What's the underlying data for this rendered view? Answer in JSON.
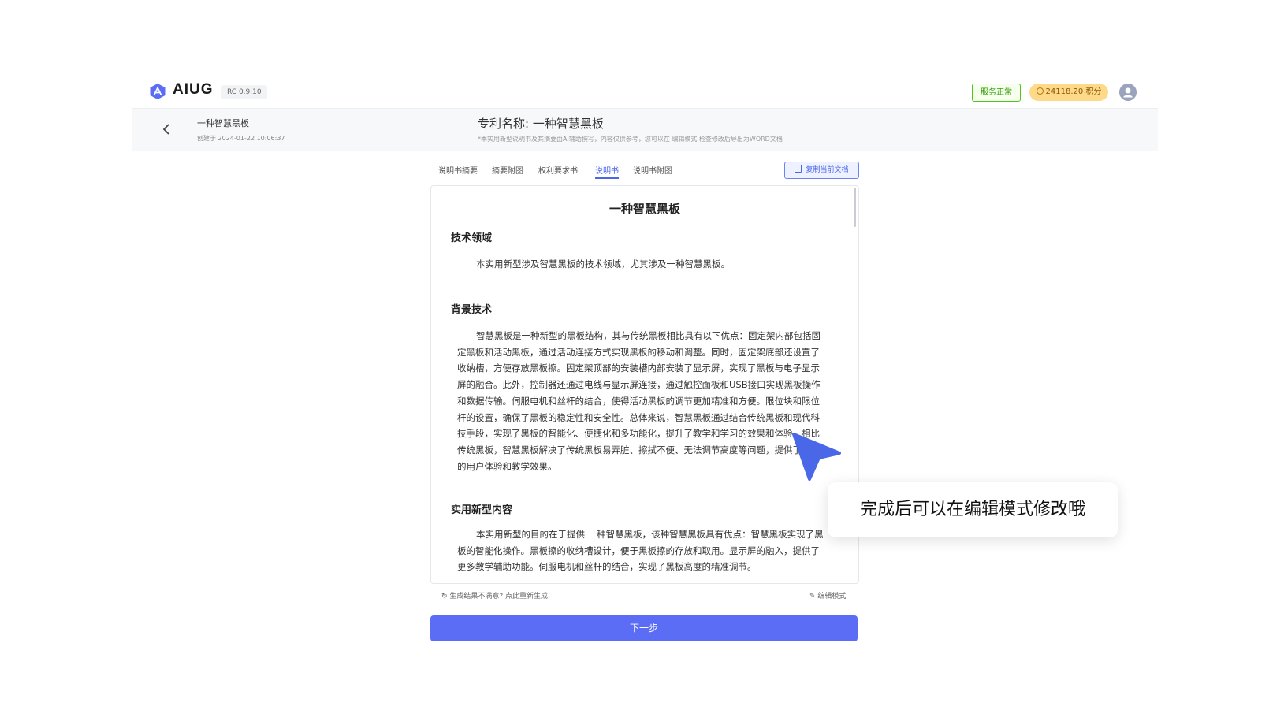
{
  "app": {
    "name": "AIUG",
    "version": "RC 0.9.10"
  },
  "topbar": {
    "status": "服务正常",
    "points": "24118.20 积分"
  },
  "header": {
    "doc_title": "一种智慧黑板",
    "created": "创建于 2024-01-22 10:06:37",
    "patent_name": "专利名称:   一种智慧黑板",
    "note": "*本实用新型说明书及其摘要由AI辅助撰写，内容仅供参考，您可以在 编辑模式 检查修改后导出为WORD文档"
  },
  "tabs": [
    {
      "label": "说明书摘要",
      "active": false
    },
    {
      "label": "摘要附图",
      "active": false
    },
    {
      "label": "权利要求书",
      "active": false
    },
    {
      "label": "说明书",
      "active": true
    },
    {
      "label": "说明书附图",
      "active": false
    }
  ],
  "copy_button": "复制当前文档",
  "document": {
    "title": "一种智慧黑板",
    "sections": [
      {
        "heading": "技术领域",
        "text": "本实用新型涉及智慧黑板的技术领域，尤其涉及一种智慧黑板。"
      },
      {
        "heading": "背景技术",
        "text": "智慧黑板是一种新型的黑板结构，其与传统黑板相比具有以下优点：固定架内部包括固定黑板和活动黑板，通过活动连接方式实现黑板的移动和调整。同时，固定架底部还设置了收纳槽，方便存放黑板擦。固定架顶部的安装槽内部安装了显示屏，实现了黑板与电子显示屏的融合。此外，控制器还通过电线与显示屏连接，通过触控面板和USB接口实现黑板操作和数据传输。伺服电机和丝杆的结合，使得活动黑板的调节更加精准和方便。限位块和限位杆的设置，确保了黑板的稳定性和安全性。总体来说，智慧黑板通过结合传统黑板和现代科技手段，实现了黑板的智能化、便捷化和多功能化，提升了教学和学习的效果和体验。相比传统黑板，智慧黑板解决了传统黑板易弄脏、擦拭不便、无法调节高度等问题，提供了更好的用户体验和教学效果。"
      },
      {
        "heading": "实用新型内容",
        "text": "本实用新型的目的在于提供 一种智慧黑板，该种智慧黑板具有优点：智慧黑板实现了黑板的智能化操作。黑板擦的收纳槽设计，便于黑板擦的存放和取用。显示屏的融入，提供了更多教学辅助功能。伺服电机和丝杆的结合，实现了黑板高度的精准调节。"
      }
    ]
  },
  "footer": {
    "regenerate": "生成结果不满意? 点此重新生成",
    "edit_mode": "编辑模式",
    "next": "下一步"
  },
  "overlay": {
    "tooltip": "完成后可以在编辑模式修改哦"
  },
  "colors": {
    "accent": "#5b6cf5",
    "status_green": "#52c41a",
    "points_bg": "#ffd98a"
  }
}
